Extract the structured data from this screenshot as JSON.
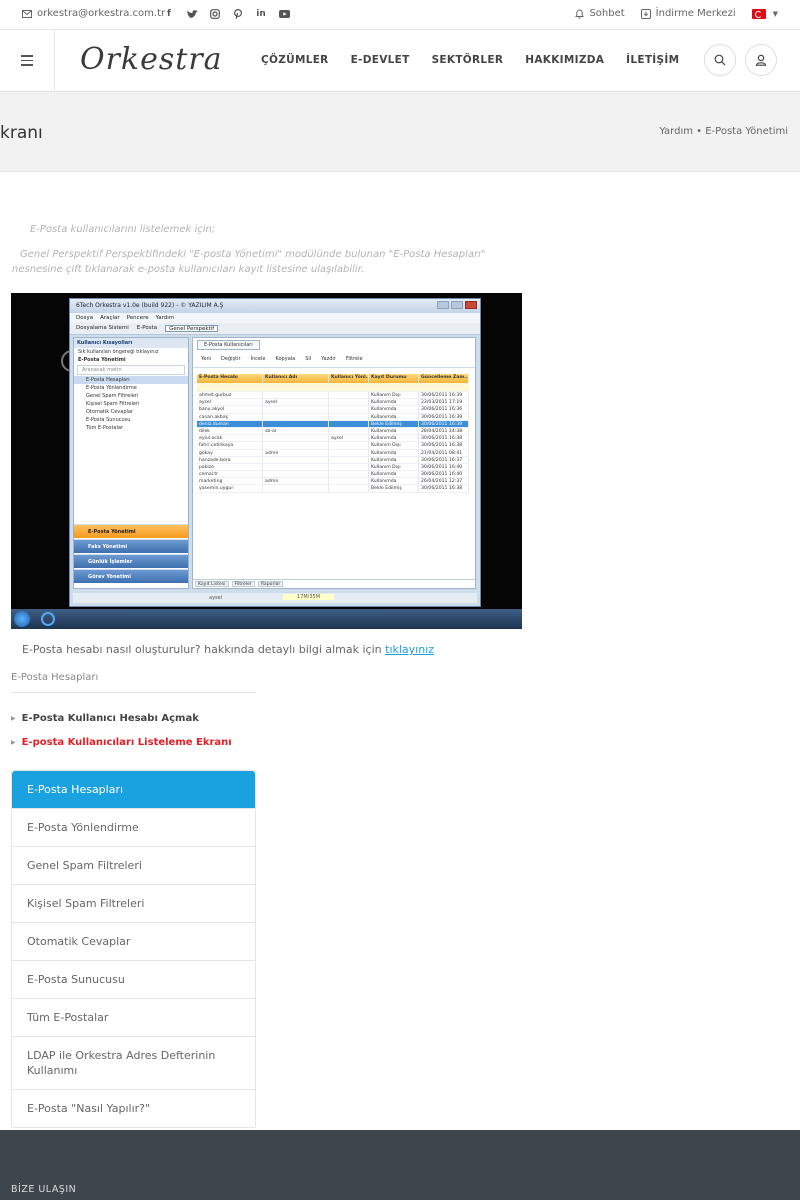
{
  "topbar": {
    "email": "orkestra@orkestra.com.tr",
    "social_icons": [
      "facebook-icon",
      "twitter-icon",
      "instagram-icon",
      "pinterest-icon",
      "linkedin-icon",
      "youtube-icon"
    ],
    "chat_label": "Sohbet",
    "download_label": "İndirme Merkezi",
    "language": "tr"
  },
  "header": {
    "logo_text": "Orkestra",
    "nav": [
      "ÇÖZÜMLER",
      "E-DEVLET",
      "SEKTÖRLER",
      "HAKKIMIZDA",
      "İLETİŞİM"
    ]
  },
  "band": {
    "title": "kranı",
    "breadcrumb": "Yardım • E-Posta Yönetimi"
  },
  "content": {
    "intro_1": "E-Posta kullanıcılarını listelemek için;",
    "intro_2": "Genel Perspektif Perspektifindeki \"E-posta Yönetimi\" modülünde bulunan \"E-Posta Hesapları\" nesnesine çift tıklanarak e-posta kullanıcıları kayıt listesine ulaşılabilir.",
    "info_prefix": "E-Posta hesabı nasıl oluşturulur? hakkında detaylı bilgi almak için ",
    "info_link": "tıklayınız",
    "section_title": "E-Posta Hesapları",
    "sub_1": "E-Posta Kullanıcı Hesabı Açmak",
    "sub_2": "E-posta Kullanıcıları Listeleme Ekranı"
  },
  "screenshot": {
    "title": "6Tech Orkestra v1.0e (build 922) - © YAZILIM A.Ş",
    "menu": [
      "Dosya",
      "Araçlar",
      "Pencere",
      "Yardım"
    ],
    "toolbar": [
      "Dosyalama Sistemi",
      "E-Posta",
      "Genel Perspektif"
    ],
    "left_header": "Kullanıcı Kısayolları",
    "left_hint": "Sık kullanılan öngereği tıklayınız",
    "left_group": "E-Posta Yönetimi",
    "left_search": "Aranacak metin",
    "left_items": [
      "E-Posta Hesapları",
      "E-Posta Yönlendirme",
      "Genel Spam Filtreleri",
      "Kişisel Spam Filtreleri",
      "Otomatik Cevaplar",
      "E-Posta Sunucusu",
      "Tüm E-Postalar"
    ],
    "nav_buttons": [
      "E-Posta Yönetimi",
      "Faks Yönetimi",
      "Günlük İşlemler",
      "Görev Yönetimi"
    ],
    "right_tab": "E-Posta Kullanıcıları",
    "right_tools": [
      "Yeni",
      "Değiştir",
      "İncele",
      "Kopyala",
      "Sil",
      "Yazdır",
      "Filtrele"
    ],
    "grid_headers": [
      "E-Posta Hesabı",
      "Kullanıcı Adı",
      "Kullanıcı Yönl..",
      "Kayıt Durumu",
      "Güncelleme Zam.."
    ],
    "grid_rows": [
      [
        "ahmet.gurbuz",
        "",
        "",
        "Kullanım Dışı",
        "30/06/2011 16:39"
      ],
      [
        "aysel",
        "aysel",
        "",
        "Kullanımda",
        "23/03/2011 17:19"
      ],
      [
        "banu.akyol",
        "",
        "",
        "Kullanımda",
        "30/06/2011 16:36"
      ],
      [
        "canan.akbaş",
        "",
        "",
        "Kullanımda",
        "30/06/2011 16:39"
      ],
      [
        "deniz.duman",
        "",
        "",
        "Bekle Edilmiş",
        "30/06/2011 16:39"
      ],
      [
        "dilek",
        "sb-ar",
        "",
        "Kullanımda",
        "28/04/2011 14:38"
      ],
      [
        "eylul.ocak",
        "",
        "aysel",
        "Kullanımda",
        "30/06/2011 16:38"
      ],
      [
        "fahri.cetinkaya",
        "",
        "",
        "Kullanım Dışı",
        "30/06/2011 16:38"
      ],
      [
        "gokay",
        "adrnn",
        "",
        "Kullanımda",
        "21/04/2011 08:41"
      ],
      [
        "hanzade.bora",
        "",
        "",
        "Kullanımda",
        "30/06/2011 16:37"
      ],
      [
        "pakize",
        "",
        "",
        "Kullanım Dışı",
        "30/06/2011 16:40"
      ],
      [
        "cemal.tr",
        "",
        "",
        "Kullanımda",
        "30/06/2011 16:40"
      ],
      [
        "marketing",
        "adrnn",
        "",
        "Kullanımda",
        "26/04/2011 12:37"
      ],
      [
        "yasemin.uygur",
        "",
        "",
        "Bekle Edilmiş",
        "30/06/2011 16:38"
      ]
    ],
    "bottom_tabs": [
      "Kayıt Listesi",
      "Filtreler",
      "Raporlar"
    ],
    "status_user": "aysel",
    "status_memory": "17M/35M"
  },
  "sidebar_menu": [
    "E-Posta Hesapları",
    "E-Posta Yönlendirme",
    "Genel Spam Filtreleri",
    "Kişisel Spam Filtreleri",
    "Otomatik Cevaplar",
    "E-Posta Sunucusu",
    "Tüm E-Postalar",
    "LDAP ile Orkestra Adres Defterinin Kullanımı",
    "E-Posta \"Nasıl Yapılır?\""
  ],
  "footer": {
    "title": "BİZE ULAŞIN"
  },
  "colors": {
    "accent": "#1aa1e0",
    "active_link": "#e31e24",
    "footer_bg": "#3d454d"
  }
}
